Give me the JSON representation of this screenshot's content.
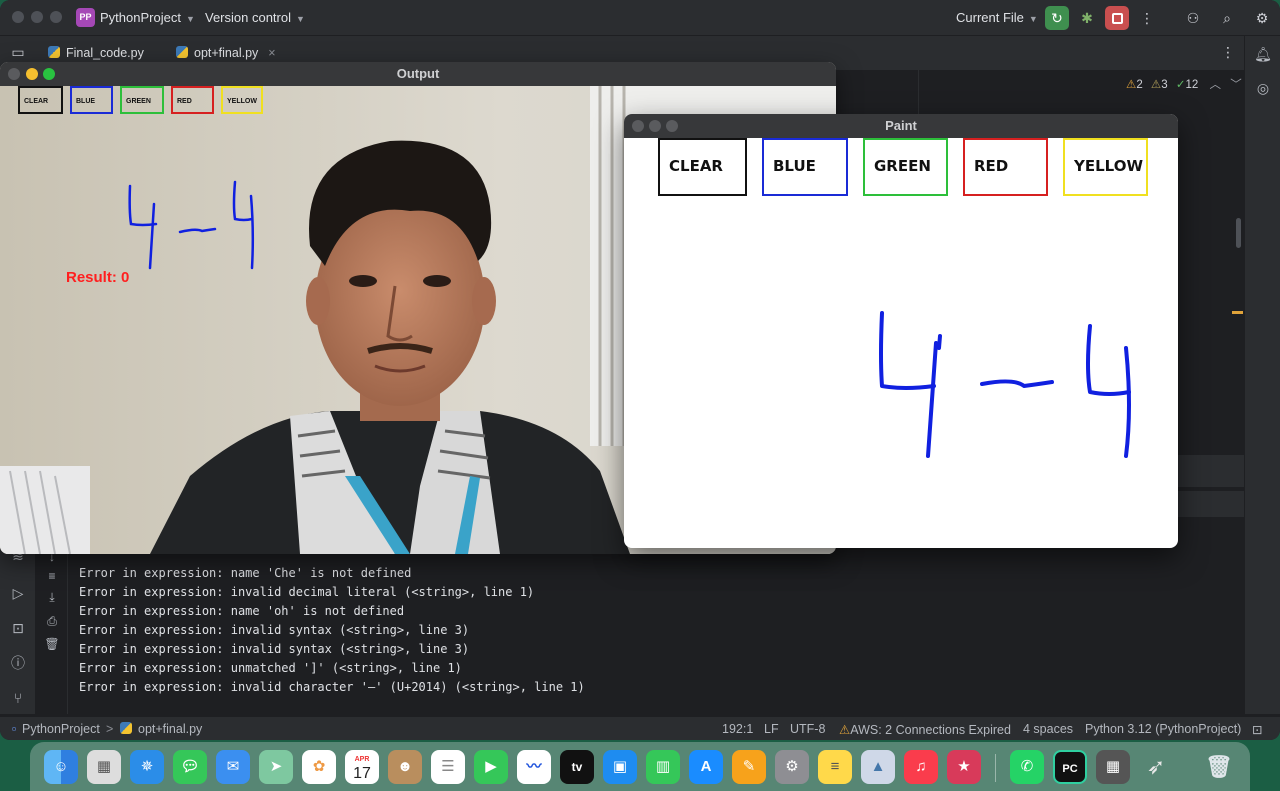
{
  "ide": {
    "project_badge": "PP",
    "project_name": "PythonProject",
    "version_control": "Version control",
    "run_config": "Current File",
    "tabs": [
      {
        "label": "Final_code.py"
      },
      {
        "label": "opt+final.py"
      }
    ],
    "tab_close": "×",
    "inspections": {
      "warn1": "2",
      "warn2": "3",
      "ok": "12"
    },
    "console_lines": [
      "Error in expression: name 'Che' is not defined",
      "Error in expression: invalid decimal literal (<string>, line 1)",
      "Error in expression: name 'oh' is not defined",
      "Error in expression: invalid syntax (<string>, line 3)",
      "Error in expression: invalid syntax (<string>, line 3)",
      "Error in expression: unmatched ']' (<string>, line 1)",
      "Error in expression: invalid character '—' (U+2014) (<string>, line 1)"
    ],
    "status": {
      "project": "PythonProject",
      "separator": ">",
      "file": "opt+final.py",
      "position": "192:1",
      "line_sep": "LF",
      "encoding": "UTF-8",
      "aws": "AWS: 2 Connections Expired",
      "indent": "4 spaces",
      "interpreter": "Python 3.12 (PythonProject)"
    }
  },
  "output_window": {
    "title": "Output",
    "swatches": [
      {
        "label": "CLEAR",
        "color": "#111111"
      },
      {
        "label": "BLUE",
        "color": "#1a2bd6"
      },
      {
        "label": "GREEN",
        "color": "#2dbf3a"
      },
      {
        "label": "RED",
        "color": "#d62020"
      },
      {
        "label": "YELLOW",
        "color": "#f0e020"
      }
    ],
    "result": "Result: 0"
  },
  "paint_window": {
    "title": "Paint",
    "swatches": [
      {
        "label": "CLEAR",
        "color": "#111111"
      },
      {
        "label": "BLUE",
        "color": "#1a2bd6"
      },
      {
        "label": "GREEN",
        "color": "#2dbf3a"
      },
      {
        "label": "RED",
        "color": "#d62020"
      },
      {
        "label": "YELLOW",
        "color": "#f0e020"
      }
    ],
    "stroke_color": "#1020e0"
  },
  "dock": {
    "calendar_month": "APR",
    "calendar_day": "17",
    "tv_label": "tv",
    "pycharm_label": "PC",
    "apps": [
      "Finder",
      "Launchpad",
      "Safari",
      "Messages",
      "Mail",
      "Maps",
      "Photos",
      "Calendar",
      "Contacts",
      "Reminders",
      "FaceTime",
      "Freeform",
      "Apple TV",
      "Keynote",
      "Numbers",
      "App Store",
      "Pages",
      "System Settings",
      "Notes",
      "Preview",
      "Music",
      "Photo Booth",
      "WhatsApp",
      "PyCharm",
      "Calculator",
      "Rocket",
      "Trash"
    ]
  }
}
